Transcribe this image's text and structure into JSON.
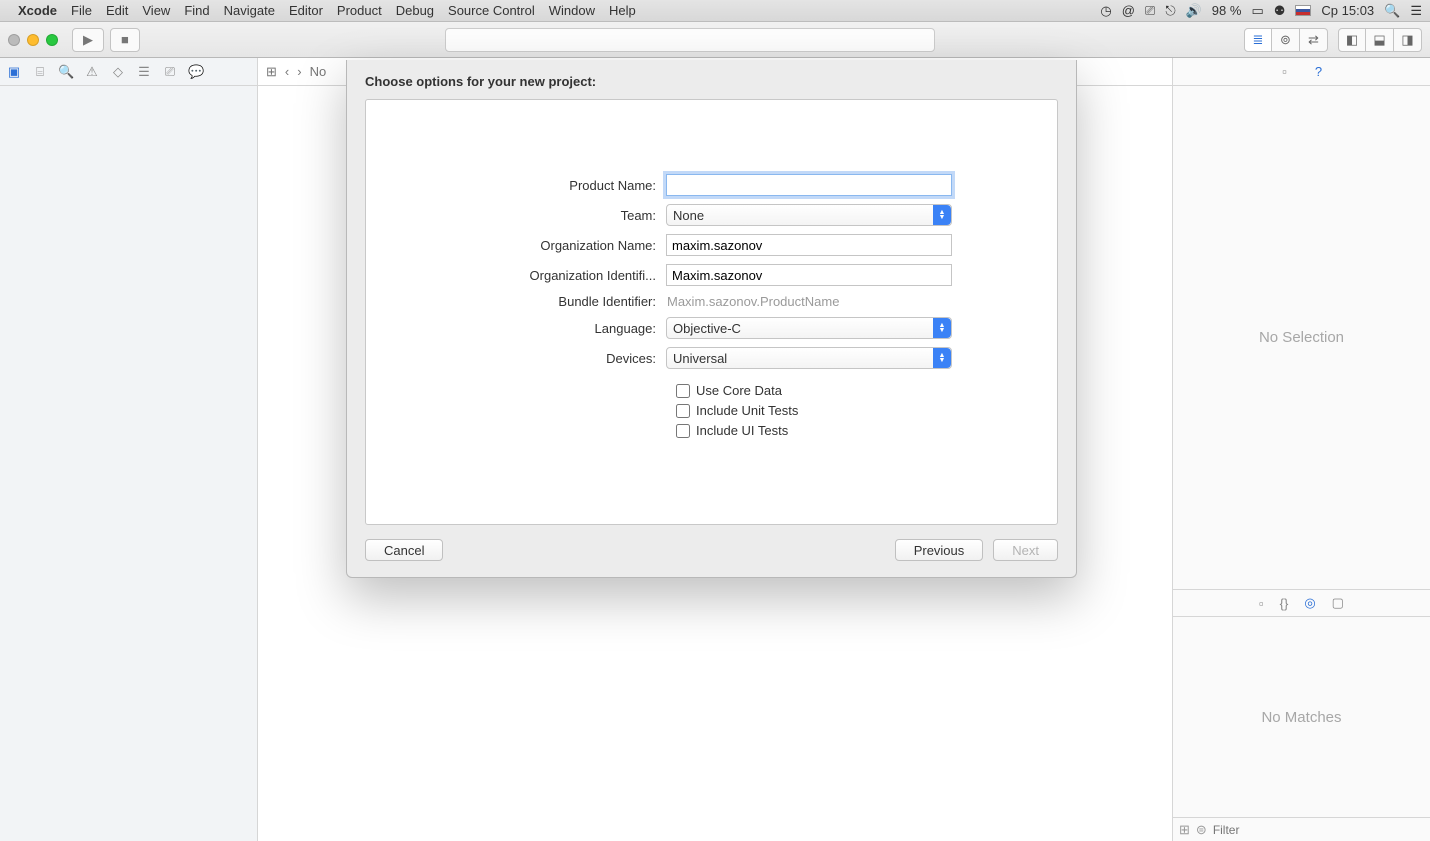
{
  "menubar": {
    "app": "Xcode",
    "items": [
      "File",
      "Edit",
      "View",
      "Find",
      "Navigate",
      "Editor",
      "Product",
      "Debug",
      "Source Control",
      "Window",
      "Help"
    ],
    "battery": "98 %",
    "clock": "Ср 15:03"
  },
  "jumpbar": {
    "crumb": "No"
  },
  "inspector": {
    "no_selection": "No Selection",
    "no_matches": "No Matches",
    "filter_placeholder": "Filter"
  },
  "sheet": {
    "title": "Choose options for your new project:",
    "labels": {
      "product": "Product Name:",
      "team": "Team:",
      "org_name": "Organization Name:",
      "org_id": "Organization Identifi...",
      "bundle": "Bundle Identifier:",
      "language": "Language:",
      "devices": "Devices:"
    },
    "values": {
      "product": "",
      "team": "None",
      "org_name": "maxim.sazonov",
      "org_id": "Maxim.sazonov",
      "bundle": "Maxim.sazonov.ProductName",
      "language": "Objective-C",
      "devices": "Universal"
    },
    "checks": {
      "coredata": "Use Core Data",
      "unit": "Include Unit Tests",
      "ui": "Include UI Tests"
    },
    "buttons": {
      "cancel": "Cancel",
      "previous": "Previous",
      "next": "Next"
    }
  }
}
